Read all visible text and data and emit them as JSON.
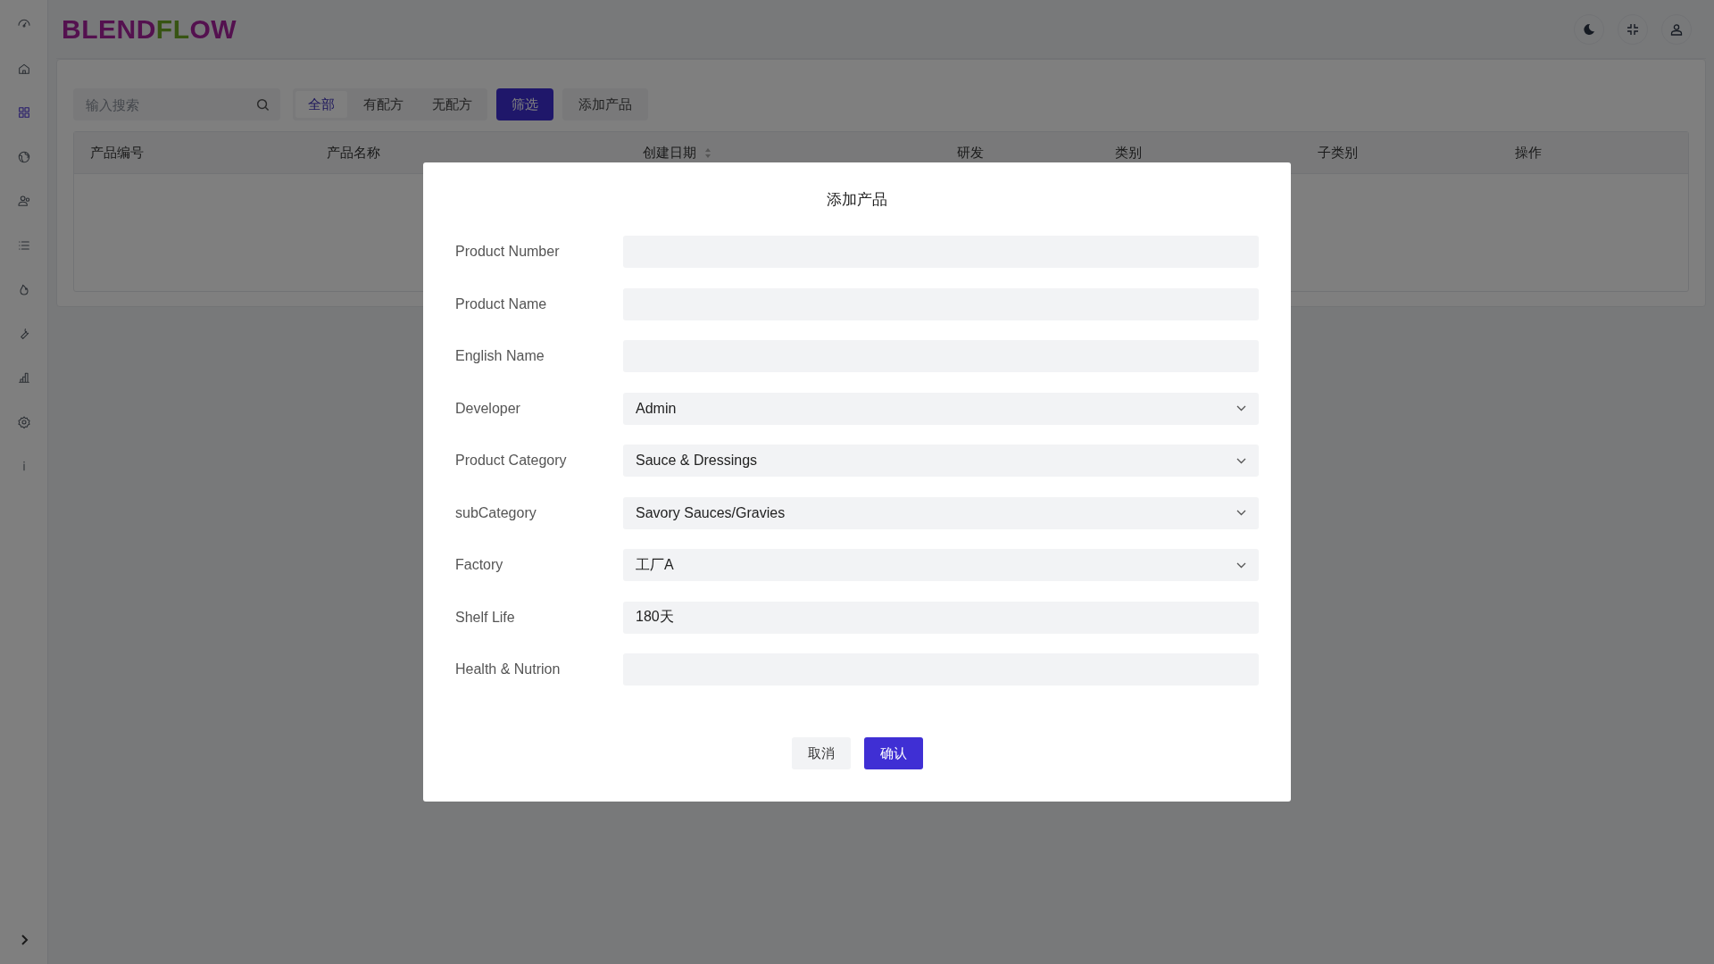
{
  "sidebar": {
    "items": [
      {
        "selected": false
      },
      {
        "selected": false
      },
      {
        "selected": true
      },
      {
        "selected": false
      },
      {
        "selected": false
      },
      {
        "selected": false
      },
      {
        "selected": false
      },
      {
        "selected": false
      },
      {
        "selected": false
      },
      {
        "selected": false
      },
      {
        "selected": false
      }
    ]
  },
  "header": {
    "logo": [
      {
        "text": "BLEND"
      },
      {
        "text": "FL"
      },
      {
        "text": "OW"
      }
    ]
  },
  "toolbar": {
    "search": {
      "placeholder": "输入搜索"
    },
    "filters": [
      {
        "label": "全部",
        "selected": true
      },
      {
        "label": "有配方",
        "selected": false
      },
      {
        "label": "无配方",
        "selected": false
      }
    ],
    "buttons": [
      {
        "label": "筛选",
        "kind": "primary"
      },
      {
        "label": "添加产品",
        "kind": "default"
      }
    ]
  },
  "table": {
    "columns": [
      {
        "label": "产品编号",
        "sortable": false
      },
      {
        "label": "产品名称",
        "sortable": false
      },
      {
        "label": "创建日期",
        "sortable": true
      },
      {
        "label": "研发",
        "sortable": false
      },
      {
        "label": "类别",
        "sortable": false
      },
      {
        "label": "子类别",
        "sortable": false
      },
      {
        "label": "操作",
        "sortable": false
      }
    ]
  },
  "dialog": {
    "title": "添加产品",
    "fields": [
      {
        "label": "Product Number",
        "kind": "text"
      },
      {
        "label": "Product Name",
        "kind": "text"
      },
      {
        "label": "English Name",
        "kind": "text"
      },
      {
        "label": "Developer",
        "kind": "select",
        "value": "Admin"
      },
      {
        "label": "Product Category",
        "kind": "select",
        "value": "Sauce & Dressings"
      },
      {
        "label": "subCategory",
        "kind": "select",
        "value": "Savory Sauces/Gravies"
      },
      {
        "label": "Factory",
        "kind": "select",
        "value": "工厂A"
      },
      {
        "label": "Shelf Life",
        "kind": "text",
        "value": "180天"
      },
      {
        "label": "Health & Nutrion",
        "kind": "text"
      }
    ],
    "buttons": [
      {
        "label": "取消",
        "kind": "default"
      },
      {
        "label": "确认",
        "kind": "primary"
      }
    ]
  }
}
